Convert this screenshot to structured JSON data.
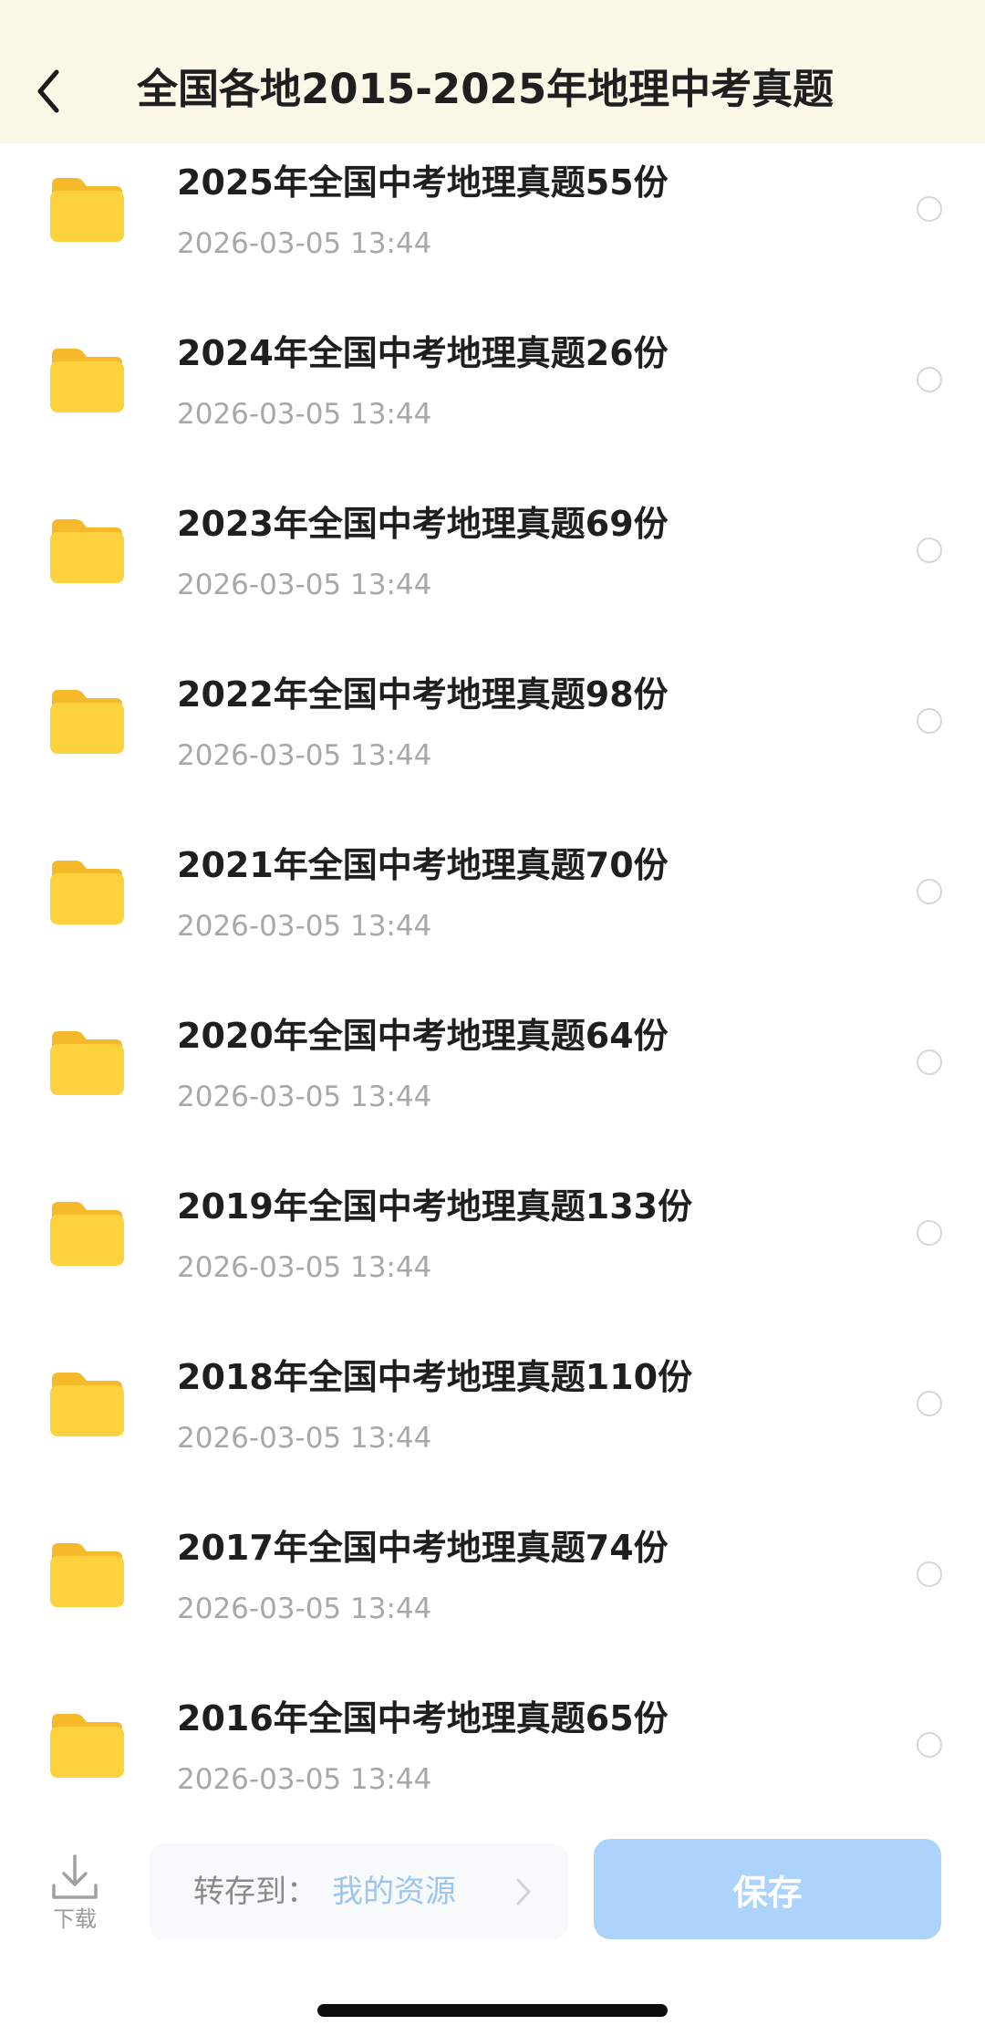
{
  "header": {
    "title": "全国各地2015-2025年地理中考真题",
    "back_icon": "chevron-left-icon"
  },
  "list": {
    "folder_icon": "folder-icon",
    "items": [
      {
        "title": "2025年全国中考地理真题55份",
        "date": "2026-03-05 13:44"
      },
      {
        "title": "2024年全国中考地理真题26份",
        "date": "2026-03-05 13:44"
      },
      {
        "title": "2023年全国中考地理真题69份",
        "date": "2026-03-05 13:44"
      },
      {
        "title": "2022年全国中考地理真题98份",
        "date": "2026-03-05 13:44"
      },
      {
        "title": "2021年全国中考地理真题70份",
        "date": "2026-03-05 13:44"
      },
      {
        "title": "2020年全国中考地理真题64份",
        "date": "2026-03-05 13:44"
      },
      {
        "title": "2019年全国中考地理真题133份",
        "date": "2026-03-05 13:44"
      },
      {
        "title": "2018年全国中考地理真题110份",
        "date": "2026-03-05 13:44"
      },
      {
        "title": "2017年全国中考地理真题74份",
        "date": "2026-03-05 13:44"
      },
      {
        "title": "2016年全国中考地理真题65份",
        "date": "2026-03-05 13:44"
      }
    ]
  },
  "bottom": {
    "download_label": "下载",
    "save_to_prefix": "转存到：",
    "save_to_target": "我的资源",
    "save_label": "保存"
  },
  "colors": {
    "header_bg": "#fcf8e8",
    "folder_yellow": "#fdd23e",
    "save_button": "#abd3fb",
    "link_blue": "#9cc6ef"
  }
}
